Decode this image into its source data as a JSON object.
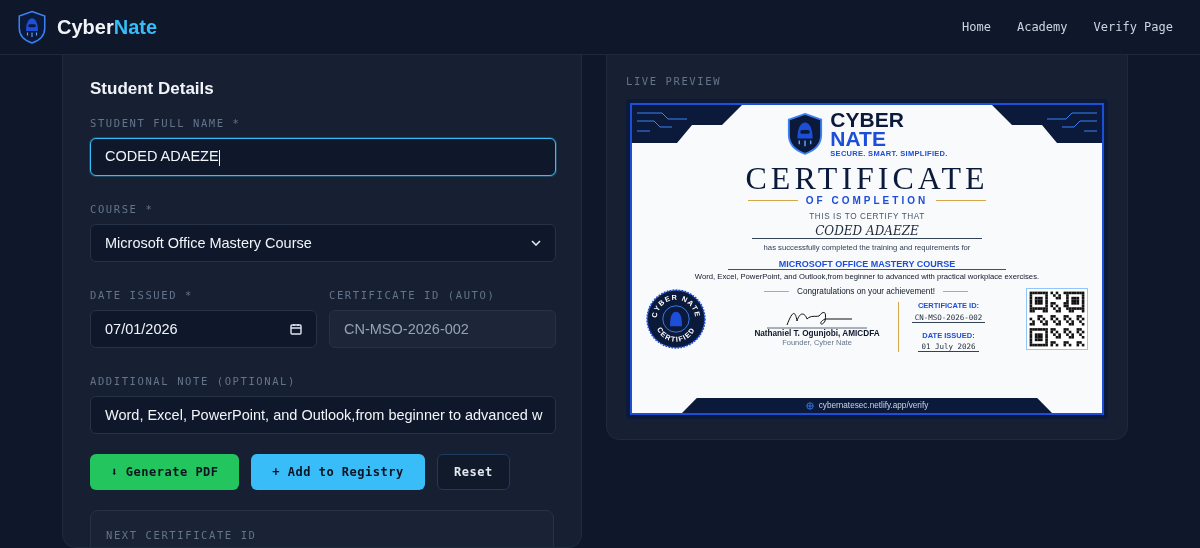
{
  "brand": {
    "name_part_1": "Cyber",
    "name_part_2": "Nate"
  },
  "nav": [
    "Home",
    "Academy",
    "Verify Page"
  ],
  "form": {
    "title": "Student Details",
    "fields": [
      {
        "kind": "text",
        "label": "STUDENT FULL NAME *",
        "value": "CODED ADAEZE",
        "focused": true
      },
      {
        "kind": "select",
        "label": "COURSE *",
        "value": "Microsoft Office Mastery Course"
      },
      {
        "kind": "date",
        "label": "DATE ISSUED *",
        "value": "07/01/2026"
      },
      {
        "kind": "readonly",
        "label": "CERTIFICATE ID (AUTO)",
        "value": "CN-MSO-2026-002"
      },
      {
        "kind": "text",
        "label": "ADDITIONAL NOTE (OPTIONAL)",
        "value": "Word, Excel, PowerPoint, and Outlook,from beginner to advanced w",
        "focused": false
      }
    ],
    "buttons": [
      {
        "kind": "success",
        "label": "⬇ Generate PDF"
      },
      {
        "kind": "info",
        "label": "+ Add to Registry"
      },
      {
        "kind": "ghost",
        "label": "Reset"
      }
    ],
    "next_id_label": "NEXT CERTIFICATE ID"
  },
  "preview": {
    "label": "LIVE PREVIEW",
    "certificate": {
      "logo_line_1": "CYBER",
      "logo_line_2": "NATE",
      "tagline": "SECURE. SMART. SIMPLIFIED.",
      "title": "CERTIFICATE",
      "subtitle": "OF COMPLETION",
      "intro": "THIS IS TO CERTIFY THAT",
      "recipient": "CODED ADAEZE",
      "statement": "has successfully completed the training and requirements for",
      "course": "MICROSOFT OFFICE MASTERY COURSE",
      "description": "Word, Excel, PowerPoint, and Outlook,from beginner to advanced with practical workplace exercises.",
      "congrats": "Congratulations on your achievement!",
      "seal_top": "CYBER NATE",
      "seal_bottom": "CERTIFIED",
      "signer": "Nathaniel T. Ogunjobi, AMICDFA",
      "signer_role": "Founder, Cyber Nate",
      "id_label": "CERTIFICATE ID:",
      "id_value": "CN-MSO-2026-002",
      "date_label": "DATE ISSUED:",
      "date_value": "01 July 2026",
      "url": "cybernatesec.netlify.app/verify"
    }
  }
}
